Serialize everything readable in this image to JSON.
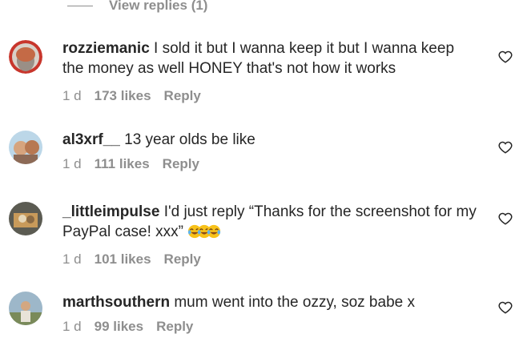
{
  "view_replies": {
    "label": "View replies (1)"
  },
  "comments": [
    {
      "username": "rozziemanic",
      "text": " I sold it but I wanna keep it but I wanna keep the money as well HONEY that's not how it works",
      "time": "1 d",
      "likes": "173 likes",
      "reply": "Reply"
    },
    {
      "username": "al3xrf__",
      "text": " 13 year olds be like",
      "time": "1 d",
      "likes": "111 likes",
      "reply": "Reply"
    },
    {
      "username": "_littleimpulse",
      "text": " I'd just reply “Thanks for the screenshot for my PayPal case! xxx” ",
      "emoji": "face-with-tears-of-joy ×3",
      "time": "1 d",
      "likes": "101 likes",
      "reply": "Reply"
    },
    {
      "username": "marthsouthern",
      "text": " mum went into the ozzy, soz babe x",
      "time": "1 d",
      "likes": "99 likes",
      "reply": "Reply"
    }
  ],
  "icons": {
    "like": "heart-outline-icon"
  },
  "colors": {
    "text": "#262626",
    "muted": "#8e8e8e",
    "background": "#ffffff"
  }
}
